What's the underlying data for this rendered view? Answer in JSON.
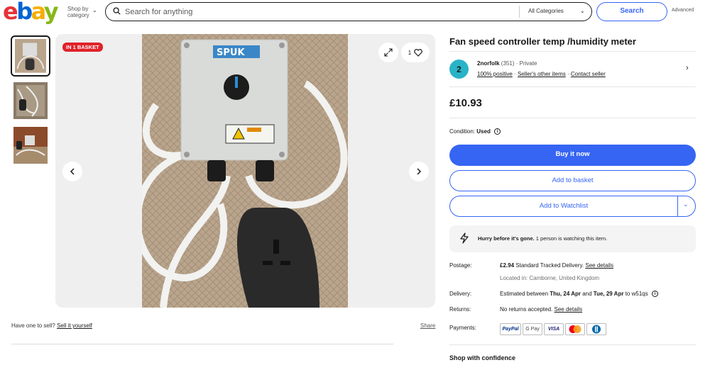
{
  "header": {
    "logo_letters": [
      "e",
      "b",
      "a",
      "y"
    ],
    "shop_by_line1": "Shop by",
    "shop_by_line2": "category",
    "search_placeholder": "Search for anything",
    "category_select": "All Categories",
    "search_button": "Search",
    "advanced_link": "Advanced"
  },
  "gallery": {
    "badge": "IN 1 BASKET",
    "watchers_count": "1",
    "photo_box_text": "SPUK",
    "thumbnails": [
      "thumbnail-1",
      "thumbnail-2",
      "thumbnail-3"
    ]
  },
  "below": {
    "have_one": "Have one to sell?",
    "sell_link": "Sell it yourself",
    "share": "Share"
  },
  "listing": {
    "title": "Fan speed controller temp /humidity meter",
    "seller": {
      "avatar_letter": "2",
      "name": "2norfolk",
      "rating": "(351)",
      "type": "· Private",
      "positive": "100% positive",
      "sep1": "·",
      "other_items": "Seller's other items",
      "sep2": "·",
      "contact": "Contact seller"
    },
    "price": "£10.93",
    "condition_label": "Condition:",
    "condition_value": "Used",
    "buttons": {
      "buy_now": "Buy it now",
      "add_basket": "Add to basket",
      "add_watchlist": "Add to Watchlist"
    },
    "hurry_bold": "Hurry before it's gone.",
    "hurry_text": " 1 person is watching this item.",
    "postage": {
      "label": "Postage:",
      "price": "£2.94",
      "service": " Standard Tracked Delivery. ",
      "details": "See details",
      "location": "Located in: Camborne, United Kingdom"
    },
    "delivery": {
      "label": "Delivery:",
      "prefix": "Estimated between ",
      "start": "Thu, 24 Apr",
      "mid": " and ",
      "end": "Tue, 29 Apr",
      "suffix": " to w51qs"
    },
    "returns": {
      "label": "Returns:",
      "text": "No returns accepted. ",
      "details": "See details"
    },
    "payments": {
      "label": "Payments:",
      "methods": [
        "PayPal",
        "G Pay",
        "VISA",
        "Mastercard",
        "Diners Club"
      ]
    },
    "shop_confidence": "Shop with confidence"
  },
  "colors": {
    "brand_blue": "#3665f3",
    "badge_red": "#e0222a",
    "avatar_teal": "#2ab3c7"
  }
}
